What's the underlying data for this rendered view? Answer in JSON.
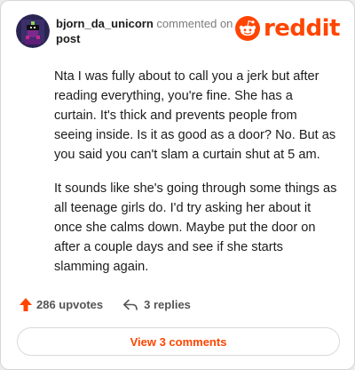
{
  "header": {
    "username": "bjorn_da_unicorn",
    "action_text": "commented on",
    "target_text": "post",
    "avatar_icon": "unicorn-avatar-icon"
  },
  "brand": {
    "name": "reddit",
    "icon": "reddit-alien-icon",
    "color": "#ff4500"
  },
  "comment": {
    "paragraphs": [
      "Nta I was fully about to call you a jerk but after reading everything, you're fine. She has a curtain. It's thick and prevents people from seeing inside. Is it as good as a door? No. But as you said you can't slam a curtain shut at 5 am.",
      "It sounds like she's going through some things as all teenage girls do. I'd try asking her about it once she calms down. Maybe put the door on after a couple days and see if she starts slamming again."
    ]
  },
  "actions": {
    "upvotes_label": "286 upvotes",
    "upvote_icon": "upvote-arrow-icon",
    "replies_label": "3 replies",
    "reply_icon": "reply-arrow-icon"
  },
  "footer": {
    "view_comments_label": "View 3 comments"
  }
}
